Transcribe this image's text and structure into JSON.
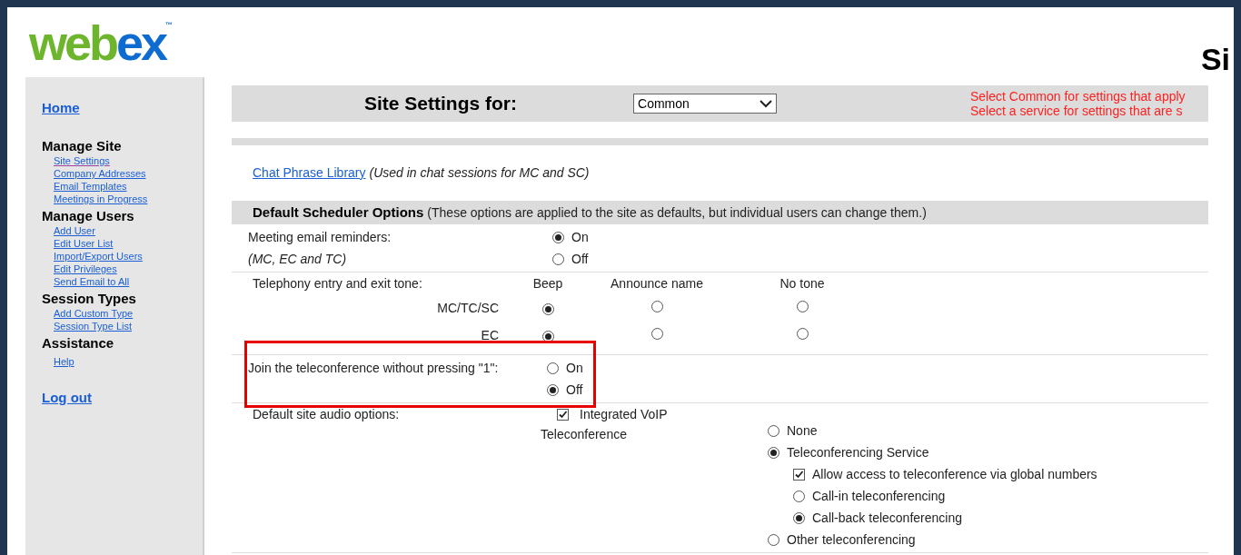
{
  "logo": {
    "part_1": "web",
    "part_2": "ex",
    "trademark": "™"
  },
  "page_title": "Si",
  "sidebar": {
    "home": "Home",
    "groups": [
      {
        "title": "Manage Site",
        "links": [
          {
            "label": "Site Settings",
            "visited": true
          },
          {
            "label": "Company Addresses",
            "visited": false
          },
          {
            "label": "Email Templates",
            "visited": false
          },
          {
            "label": "Meetings in Progress",
            "visited": false
          }
        ]
      },
      {
        "title": "Manage Users",
        "links": [
          {
            "label": "Add User",
            "visited": false
          },
          {
            "label": "Edit User List",
            "visited": false
          },
          {
            "label": "Import/Export Users",
            "visited": false
          },
          {
            "label": "Edit Privileges",
            "visited": false
          },
          {
            "label": "Send Email to All",
            "visited": false
          }
        ]
      },
      {
        "title": "Session Types",
        "links": [
          {
            "label": "Add Custom Type",
            "visited": false
          },
          {
            "label": "Session Type List",
            "visited": false
          }
        ]
      },
      {
        "title": "Assistance",
        "links": [
          {
            "label": "Help",
            "visited": false
          }
        ]
      }
    ],
    "logout": "Log out"
  },
  "header": {
    "title": "Site Settings for:",
    "select": "Common",
    "notes": [
      "Select Common for settings that apply",
      "Select a service for settings that are s"
    ]
  },
  "chat_phrase": {
    "link": "Chat Phrase Library",
    "note": "(Used in chat sessions for MC and SC)"
  },
  "scheduler": {
    "title": "Default Scheduler Options",
    "note": "(These options are applied to the site as defaults, but individual users can change them.)",
    "reminders": {
      "label": "Meeting email reminders:",
      "sublabel": "(MC, EC and TC)",
      "options": [
        {
          "label": "On",
          "selected": true
        },
        {
          "label": "Off",
          "selected": false
        }
      ]
    },
    "tone": {
      "label": "Telephony entry and exit tone:",
      "columns": [
        "Beep",
        "Announce name",
        "No tone"
      ],
      "rows": [
        {
          "label": "MC/TC/SC",
          "selected": [
            true,
            false,
            false
          ]
        },
        {
          "label": "EC",
          "selected": [
            true,
            false,
            false
          ]
        }
      ]
    },
    "join": {
      "label": "Join the teleconference without pressing \"1\":",
      "highlighted": true,
      "options": [
        {
          "label": "On",
          "selected": false
        },
        {
          "label": "Off",
          "selected": true
        }
      ]
    },
    "audio": {
      "label": "Default site audio options:",
      "voip": {
        "label": "Integrated VoIP",
        "checked": true
      },
      "teleconference": "Teleconference",
      "options": [
        {
          "label": "None",
          "selected": false
        },
        {
          "label": "Teleconferencing Service",
          "selected": true,
          "global": {
            "label": "Allow access to teleconference via global numbers",
            "checked": true
          },
          "children": [
            {
              "label": "Call-in teleconferencing",
              "selected": false
            },
            {
              "label": "Call-back teleconferencing",
              "selected": true
            }
          ]
        },
        {
          "label": "Other teleconferencing",
          "selected": false
        }
      ]
    }
  }
}
